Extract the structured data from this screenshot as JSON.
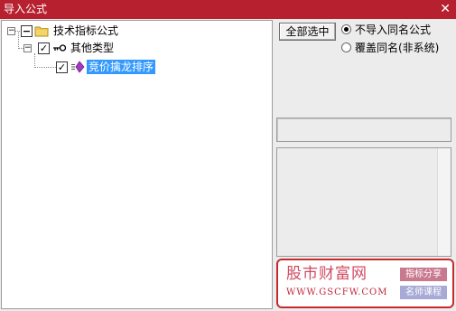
{
  "window": {
    "title": "导入公式",
    "close_glyph": "✕"
  },
  "tree": {
    "expander_glyph": "−",
    "check_glyph": "✓",
    "nodes": [
      {
        "label": "技术指标公式",
        "checked": true,
        "icon": "folder-icon"
      },
      {
        "label": "其他类型",
        "checked": true,
        "icon": "key-icon"
      },
      {
        "label": "竞价擒龙排序",
        "checked": true,
        "icon": "formula-diamond-icon",
        "selected": true
      }
    ]
  },
  "options": {
    "select_all_label": "全部选中",
    "radio_no_import": "不导入同名公式",
    "radio_overwrite": "覆盖同名(非系统)",
    "selected_radio": "radio_no_import"
  },
  "promo": {
    "brand_name": "股市财富网",
    "brand_url": "WWW.GSCFW.COM",
    "tag_indicator_share": "指标分享",
    "tag_teacher_course": "名师课程"
  },
  "colors": {
    "titlebar": "#b7202e",
    "selection": "#3399ff",
    "promo_border": "#c52a2f"
  }
}
